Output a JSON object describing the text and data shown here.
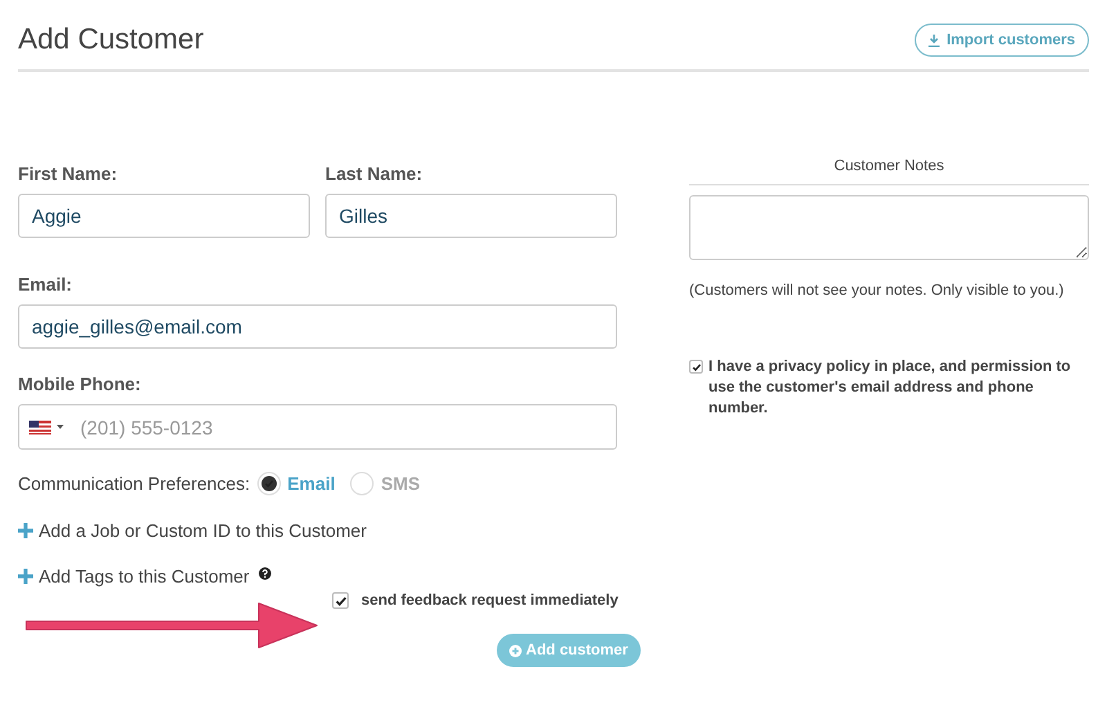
{
  "header": {
    "title": "Add Customer",
    "import_button": "Import customers"
  },
  "name_fields": [
    {
      "label": "First Name:",
      "value": "Aggie"
    },
    {
      "label": "Last Name:",
      "value": "Gilles"
    }
  ],
  "email": {
    "label": "Email:",
    "value": "aggie_gilles@email.com"
  },
  "phone": {
    "label": "Mobile Phone:",
    "placeholder": "(201) 555-0123"
  },
  "communication": {
    "label": "Communication Preferences:",
    "options": [
      {
        "label": "Email",
        "selected": true
      },
      {
        "label": "SMS",
        "selected": false
      }
    ]
  },
  "links": [
    "Add a Job or Custom ID to this Customer",
    "Add Tags to this Customer"
  ],
  "send_feedback": {
    "label": "send feedback request immediately",
    "checked": true
  },
  "submit_button": "Add customer",
  "notes": {
    "title": "Customer Notes",
    "hint": "(Customers will not see your notes. Only visible to you.)"
  },
  "privacy": {
    "label": "I have a privacy policy in place, and permission to use the customer's email address and phone number.",
    "checked": true
  }
}
